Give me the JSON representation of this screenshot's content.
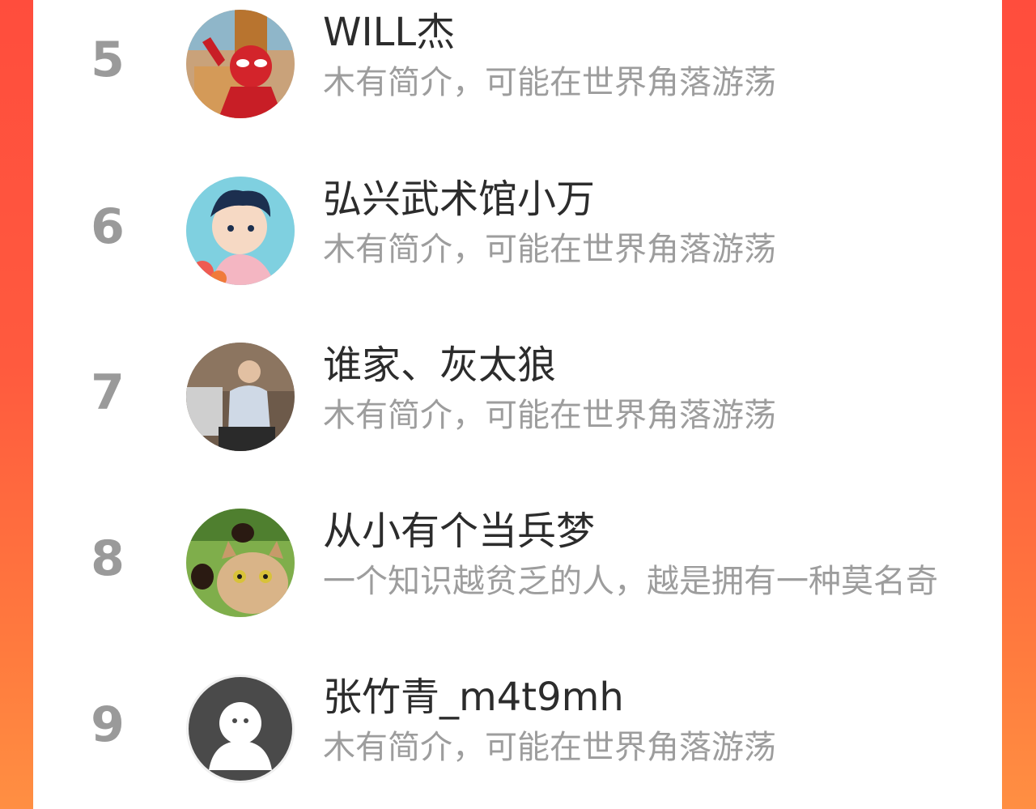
{
  "colors": {
    "accent_left": "#ff4d3d",
    "accent_right": "#ff8f42",
    "rank": "#9a9a9a",
    "name": "#2c2c2c",
    "bio": "#9d9d9d"
  },
  "users": [
    {
      "rank": "5",
      "name": "WILL杰",
      "bio": "木有简介，可能在世界角落游荡",
      "avatar": "spiderman-avatar"
    },
    {
      "rank": "6",
      "name": "弘兴武术馆小万",
      "bio": "木有简介，可能在世界角落游荡",
      "avatar": "anime-boy-avatar"
    },
    {
      "rank": "7",
      "name": "谁家、灰太狼",
      "bio": "木有简介，可能在世界角落游荡",
      "avatar": "photo-man-avatar"
    },
    {
      "rank": "8",
      "name": "从小有个当兵梦",
      "bio": "一个知识越贫乏的人，越是拥有一种莫名奇",
      "avatar": "cat-dogs-avatar"
    },
    {
      "rank": "9",
      "name": "张竹青_m4t9mh",
      "bio": "木有简介，可能在世界角落游荡",
      "avatar": "default-user-avatar"
    }
  ]
}
